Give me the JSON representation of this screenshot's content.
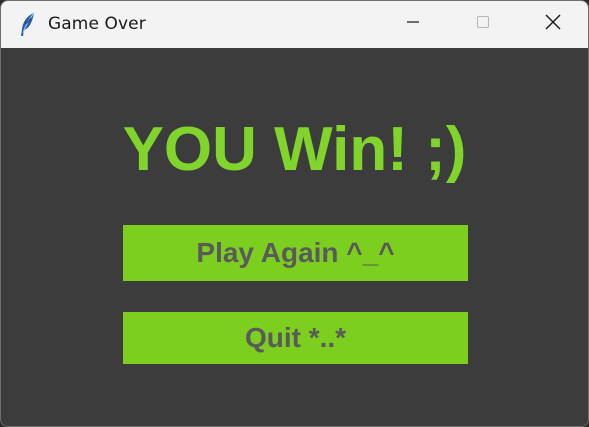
{
  "window": {
    "title": "Game Over",
    "icon": "feather-icon",
    "controls": [
      "minimize-icon",
      "maximize-icon",
      "close-icon"
    ]
  },
  "main": {
    "headline": "YOU Win! ;)",
    "play_again_label": "Play Again ^_^",
    "quit_label": "Quit *..*"
  },
  "colors": {
    "background": "#3c3c3c",
    "accent_green": "#7ccf1f",
    "headline_green": "#80d42c",
    "button_text": "#5a5a5a",
    "titlebar": "#f3f3f3"
  }
}
